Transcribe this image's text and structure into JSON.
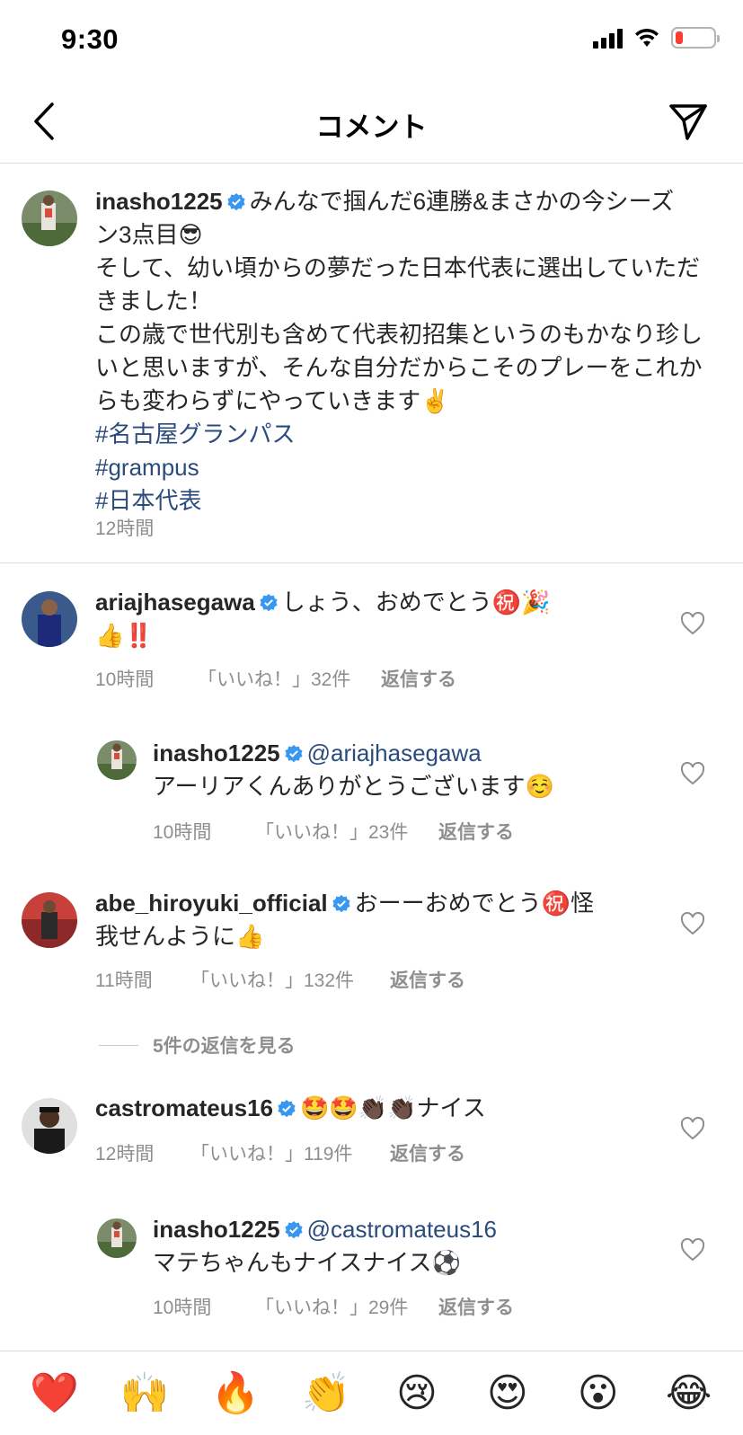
{
  "status": {
    "time": "9:30"
  },
  "nav": {
    "title": "コメント"
  },
  "caption": {
    "username": "inasho1225",
    "line1": "みんなで掴んだ6連勝&まさかの今シーズ",
    "line2": "ン3点目😎",
    "line3": "そして、幼い頃からの夢だった日本代表に選出していただ",
    "line4": "きました！",
    "line5": "この歳で世代別も含めて代表初招集というのもかなり珍し",
    "line6": "いと思いますが、そんな自分だからこそのプレーをこれか",
    "line7": "らも変わらずにやっていきます✌️",
    "hashtags": [
      "#名古屋グランパス",
      "#grampus",
      "#日本代表"
    ],
    "time": "12時間"
  },
  "comments": [
    {
      "username": "ariajhasegawa",
      "text1": "しょう、おめでとう㊗️🎉",
      "text2": "👍‼️",
      "time": "10時間",
      "likes": "「いいね！」32件",
      "reply": "返信する"
    },
    {
      "username": "inasho1225",
      "mention": "@ariajhasegawa",
      "text1": "アーリアくんありがとうございます☺️",
      "time": "10時間",
      "likes": "「いいね！」23件",
      "reply": "返信する"
    },
    {
      "username": "abe_hiroyuki_official",
      "text1": "おーーおめでとう㊗️怪",
      "text2": "我せんように👍",
      "time": "11時間",
      "likes": "「いいね！」132件",
      "reply": "返信する"
    },
    {
      "username": "castromateus16",
      "text1": "🤩🤩👏🏿👏🏿ナイス",
      "time": "12時間",
      "likes": "「いいね！」119件",
      "reply": "返信する"
    },
    {
      "username": "inasho1225",
      "mention": "@castromateus16",
      "text1": "マテちゃんもナイスナイス⚽",
      "time": "10時間",
      "likes": "「いいね！」29件",
      "reply": "返信する"
    }
  ],
  "view_replies": "5件の返信を見る",
  "emoji_bar": [
    "❤️",
    "🙌",
    "🔥",
    "👏",
    "😢",
    "😍",
    "😮",
    "😂"
  ],
  "colors": {
    "link": "#2a4b7c",
    "verified": "#3897f0",
    "muted": "#8e8e8e"
  }
}
